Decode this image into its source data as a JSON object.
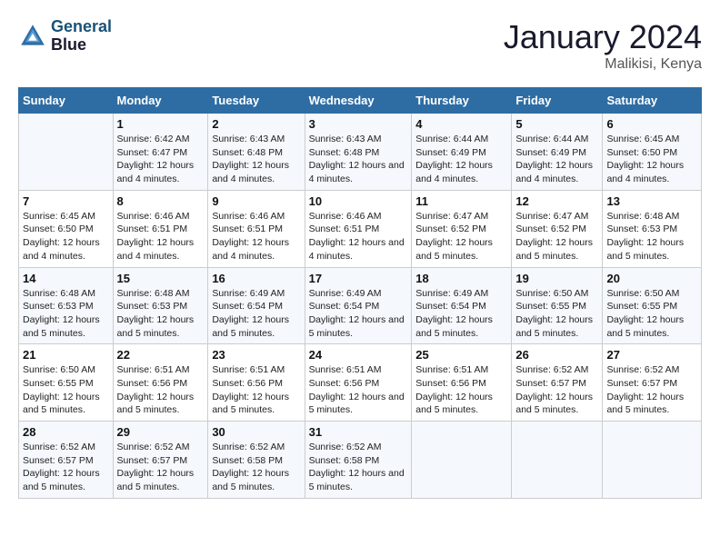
{
  "logo": {
    "line1": "General",
    "line2": "Blue"
  },
  "title": "January 2024",
  "location": "Malikisi, Kenya",
  "days_of_week": [
    "Sunday",
    "Monday",
    "Tuesday",
    "Wednesday",
    "Thursday",
    "Friday",
    "Saturday"
  ],
  "weeks": [
    [
      {
        "day": "",
        "sunrise": "",
        "sunset": "",
        "daylight": ""
      },
      {
        "day": "1",
        "sunrise": "Sunrise: 6:42 AM",
        "sunset": "Sunset: 6:47 PM",
        "daylight": "Daylight: 12 hours and 4 minutes."
      },
      {
        "day": "2",
        "sunrise": "Sunrise: 6:43 AM",
        "sunset": "Sunset: 6:48 PM",
        "daylight": "Daylight: 12 hours and 4 minutes."
      },
      {
        "day": "3",
        "sunrise": "Sunrise: 6:43 AM",
        "sunset": "Sunset: 6:48 PM",
        "daylight": "Daylight: 12 hours and 4 minutes."
      },
      {
        "day": "4",
        "sunrise": "Sunrise: 6:44 AM",
        "sunset": "Sunset: 6:49 PM",
        "daylight": "Daylight: 12 hours and 4 minutes."
      },
      {
        "day": "5",
        "sunrise": "Sunrise: 6:44 AM",
        "sunset": "Sunset: 6:49 PM",
        "daylight": "Daylight: 12 hours and 4 minutes."
      },
      {
        "day": "6",
        "sunrise": "Sunrise: 6:45 AM",
        "sunset": "Sunset: 6:50 PM",
        "daylight": "Daylight: 12 hours and 4 minutes."
      }
    ],
    [
      {
        "day": "7",
        "sunrise": "Sunrise: 6:45 AM",
        "sunset": "Sunset: 6:50 PM",
        "daylight": "Daylight: 12 hours and 4 minutes."
      },
      {
        "day": "8",
        "sunrise": "Sunrise: 6:46 AM",
        "sunset": "Sunset: 6:51 PM",
        "daylight": "Daylight: 12 hours and 4 minutes."
      },
      {
        "day": "9",
        "sunrise": "Sunrise: 6:46 AM",
        "sunset": "Sunset: 6:51 PM",
        "daylight": "Daylight: 12 hours and 4 minutes."
      },
      {
        "day": "10",
        "sunrise": "Sunrise: 6:46 AM",
        "sunset": "Sunset: 6:51 PM",
        "daylight": "Daylight: 12 hours and 4 minutes."
      },
      {
        "day": "11",
        "sunrise": "Sunrise: 6:47 AM",
        "sunset": "Sunset: 6:52 PM",
        "daylight": "Daylight: 12 hours and 5 minutes."
      },
      {
        "day": "12",
        "sunrise": "Sunrise: 6:47 AM",
        "sunset": "Sunset: 6:52 PM",
        "daylight": "Daylight: 12 hours and 5 minutes."
      },
      {
        "day": "13",
        "sunrise": "Sunrise: 6:48 AM",
        "sunset": "Sunset: 6:53 PM",
        "daylight": "Daylight: 12 hours and 5 minutes."
      }
    ],
    [
      {
        "day": "14",
        "sunrise": "Sunrise: 6:48 AM",
        "sunset": "Sunset: 6:53 PM",
        "daylight": "Daylight: 12 hours and 5 minutes."
      },
      {
        "day": "15",
        "sunrise": "Sunrise: 6:48 AM",
        "sunset": "Sunset: 6:53 PM",
        "daylight": "Daylight: 12 hours and 5 minutes."
      },
      {
        "day": "16",
        "sunrise": "Sunrise: 6:49 AM",
        "sunset": "Sunset: 6:54 PM",
        "daylight": "Daylight: 12 hours and 5 minutes."
      },
      {
        "day": "17",
        "sunrise": "Sunrise: 6:49 AM",
        "sunset": "Sunset: 6:54 PM",
        "daylight": "Daylight: 12 hours and 5 minutes."
      },
      {
        "day": "18",
        "sunrise": "Sunrise: 6:49 AM",
        "sunset": "Sunset: 6:54 PM",
        "daylight": "Daylight: 12 hours and 5 minutes."
      },
      {
        "day": "19",
        "sunrise": "Sunrise: 6:50 AM",
        "sunset": "Sunset: 6:55 PM",
        "daylight": "Daylight: 12 hours and 5 minutes."
      },
      {
        "day": "20",
        "sunrise": "Sunrise: 6:50 AM",
        "sunset": "Sunset: 6:55 PM",
        "daylight": "Daylight: 12 hours and 5 minutes."
      }
    ],
    [
      {
        "day": "21",
        "sunrise": "Sunrise: 6:50 AM",
        "sunset": "Sunset: 6:55 PM",
        "daylight": "Daylight: 12 hours and 5 minutes."
      },
      {
        "day": "22",
        "sunrise": "Sunrise: 6:51 AM",
        "sunset": "Sunset: 6:56 PM",
        "daylight": "Daylight: 12 hours and 5 minutes."
      },
      {
        "day": "23",
        "sunrise": "Sunrise: 6:51 AM",
        "sunset": "Sunset: 6:56 PM",
        "daylight": "Daylight: 12 hours and 5 minutes."
      },
      {
        "day": "24",
        "sunrise": "Sunrise: 6:51 AM",
        "sunset": "Sunset: 6:56 PM",
        "daylight": "Daylight: 12 hours and 5 minutes."
      },
      {
        "day": "25",
        "sunrise": "Sunrise: 6:51 AM",
        "sunset": "Sunset: 6:56 PM",
        "daylight": "Daylight: 12 hours and 5 minutes."
      },
      {
        "day": "26",
        "sunrise": "Sunrise: 6:52 AM",
        "sunset": "Sunset: 6:57 PM",
        "daylight": "Daylight: 12 hours and 5 minutes."
      },
      {
        "day": "27",
        "sunrise": "Sunrise: 6:52 AM",
        "sunset": "Sunset: 6:57 PM",
        "daylight": "Daylight: 12 hours and 5 minutes."
      }
    ],
    [
      {
        "day": "28",
        "sunrise": "Sunrise: 6:52 AM",
        "sunset": "Sunset: 6:57 PM",
        "daylight": "Daylight: 12 hours and 5 minutes."
      },
      {
        "day": "29",
        "sunrise": "Sunrise: 6:52 AM",
        "sunset": "Sunset: 6:57 PM",
        "daylight": "Daylight: 12 hours and 5 minutes."
      },
      {
        "day": "30",
        "sunrise": "Sunrise: 6:52 AM",
        "sunset": "Sunset: 6:58 PM",
        "daylight": "Daylight: 12 hours and 5 minutes."
      },
      {
        "day": "31",
        "sunrise": "Sunrise: 6:52 AM",
        "sunset": "Sunset: 6:58 PM",
        "daylight": "Daylight: 12 hours and 5 minutes."
      },
      {
        "day": "",
        "sunrise": "",
        "sunset": "",
        "daylight": ""
      },
      {
        "day": "",
        "sunrise": "",
        "sunset": "",
        "daylight": ""
      },
      {
        "day": "",
        "sunrise": "",
        "sunset": "",
        "daylight": ""
      }
    ]
  ]
}
